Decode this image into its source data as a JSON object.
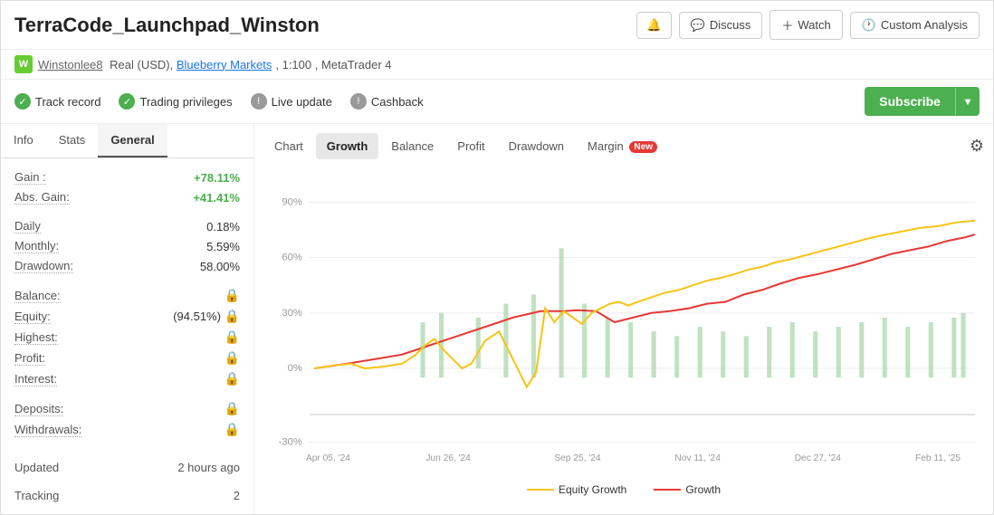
{
  "header": {
    "title": "TerraCode_Launchpad_Winston",
    "discuss_label": "Discuss",
    "watch_label": "Watch",
    "custom_analysis_label": "Custom Analysis"
  },
  "subheader": {
    "avatar_letter": "W",
    "username": "Winstonlee8",
    "account_type": "Real (USD),",
    "broker": "Blueberry Markets",
    "leverage": ", 1:100 , MetaTrader 4"
  },
  "badges": [
    {
      "id": "track-record",
      "label": "Track record",
      "type": "green"
    },
    {
      "id": "trading-privileges",
      "label": "Trading privileges",
      "type": "green"
    },
    {
      "id": "live-update",
      "label": "Live update",
      "type": "gray"
    },
    {
      "id": "cashback",
      "label": "Cashback",
      "type": "gray"
    }
  ],
  "subscribe_label": "Subscribe",
  "left_panel": {
    "tabs": [
      "Info",
      "Stats",
      "General"
    ],
    "active_tab": "General",
    "stats": {
      "gain_label": "Gain :",
      "gain_value": "+78.11%",
      "abs_gain_label": "Abs. Gain:",
      "abs_gain_value": "+41.41%",
      "daily_label": "Daily",
      "daily_value": "0.18%",
      "monthly_label": "Monthly:",
      "monthly_value": "5.59%",
      "drawdown_label": "Drawdown:",
      "drawdown_value": "58.00%",
      "balance_label": "Balance:",
      "equity_label": "Equity:",
      "equity_value": "(94.51%)",
      "highest_label": "Highest:",
      "profit_label": "Profit:",
      "interest_label": "Interest:",
      "deposits_label": "Deposits:",
      "withdrawals_label": "Withdrawals:",
      "updated_label": "Updated",
      "updated_value": "2 hours ago",
      "tracking_label": "Tracking",
      "tracking_value": "2"
    }
  },
  "right_panel": {
    "chart_tabs": [
      "Chart",
      "Growth",
      "Balance",
      "Profit",
      "Drawdown"
    ],
    "margin_label": "Margin",
    "margin_new_badge": "New",
    "active_chart_tab": "Growth",
    "chart": {
      "y_labels": [
        "90%",
        "60%",
        "30%",
        "0%",
        "-30%"
      ],
      "x_labels": [
        "Apr 05, '24",
        "Jun 26, '24",
        "Sep 25, '24",
        "Nov 11, '24",
        "Dec 27, '24",
        "Feb 11, '25"
      ],
      "legend": [
        {
          "label": "Equity Growth",
          "color": "#f5c518"
        },
        {
          "label": "Growth",
          "color": "#e53935"
        }
      ]
    }
  }
}
